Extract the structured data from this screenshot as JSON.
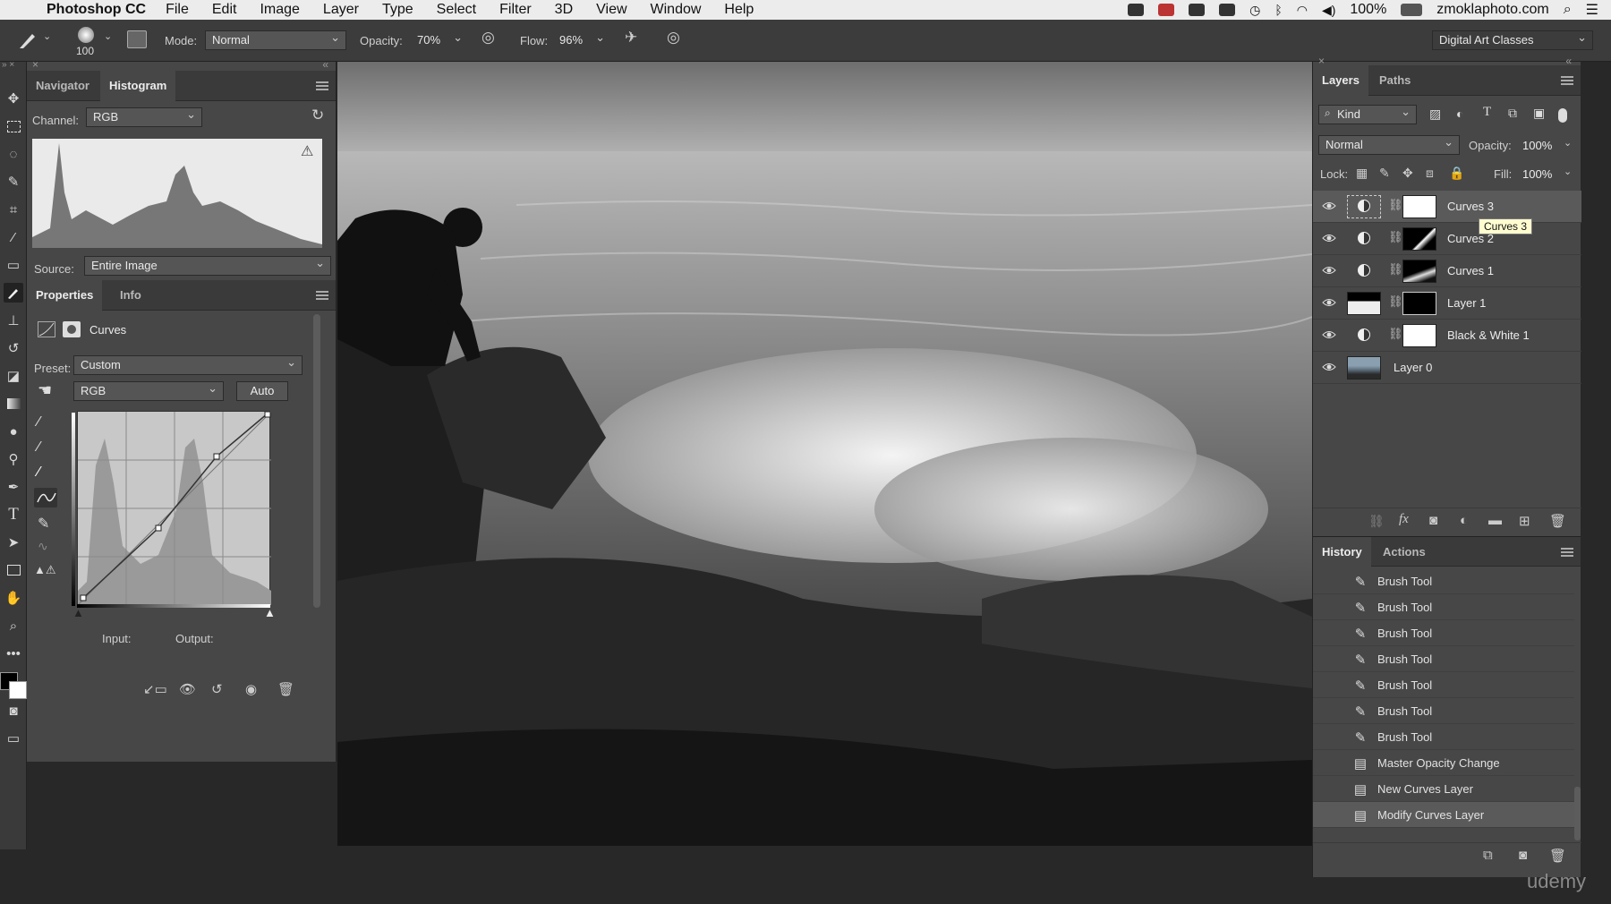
{
  "menubar": {
    "apple_glyph": "",
    "app_name": "Photoshop CC",
    "items": [
      "File",
      "Edit",
      "Image",
      "Layer",
      "Type",
      "Select",
      "Filter",
      "3D",
      "View",
      "Window",
      "Help"
    ],
    "battery": "100%",
    "site": "zmoklaphoto.com"
  },
  "options": {
    "brush_size": "100",
    "mode_label": "Mode:",
    "mode_value": "Normal",
    "opacity_label": "Opacity:",
    "opacity_value": "70%",
    "flow_label": "Flow:",
    "flow_value": "96%",
    "workspace": "Digital Art Classes"
  },
  "histogram_panel": {
    "tabs": [
      "Navigator",
      "Histogram"
    ],
    "channel_label": "Channel:",
    "channel_value": "RGB",
    "source_label": "Source:",
    "source_value": "Entire Image"
  },
  "properties_panel": {
    "tabs": [
      "Properties",
      "Info"
    ],
    "type_label": "Curves",
    "preset_label": "Preset:",
    "preset_value": "Custom",
    "channel_value": "RGB",
    "auto_label": "Auto",
    "input_label": "Input:",
    "output_label": "Output:"
  },
  "layers_panel": {
    "tabs": [
      "Layers",
      "Paths"
    ],
    "filter_value": "Kind",
    "blend_value": "Normal",
    "opacity_label": "Opacity:",
    "opacity_value": "100%",
    "lock_label": "Lock:",
    "fill_label": "Fill:",
    "fill_value": "100%",
    "tooltip": "Curves 3",
    "layers": [
      {
        "name": "Curves 3"
      },
      {
        "name": "Curves 2"
      },
      {
        "name": "Curves 1"
      },
      {
        "name": "Layer 1"
      },
      {
        "name": "Black & White 1"
      },
      {
        "name": "Layer 0"
      }
    ]
  },
  "history_panel": {
    "tabs": [
      "History",
      "Actions"
    ],
    "items": [
      {
        "label": "Brush Tool",
        "icon": "brush-icon"
      },
      {
        "label": "Brush Tool",
        "icon": "brush-icon"
      },
      {
        "label": "Brush Tool",
        "icon": "brush-icon"
      },
      {
        "label": "Brush Tool",
        "icon": "brush-icon"
      },
      {
        "label": "Brush Tool",
        "icon": "brush-icon"
      },
      {
        "label": "Brush Tool",
        "icon": "brush-icon"
      },
      {
        "label": "Brush Tool",
        "icon": "brush-icon"
      },
      {
        "label": "Master Opacity Change",
        "icon": "document-icon"
      },
      {
        "label": "New Curves Layer",
        "icon": "document-icon"
      },
      {
        "label": "Modify Curves Layer",
        "icon": "document-icon"
      }
    ]
  },
  "watermark": "udemy",
  "colors": {
    "panel_bg": "#474747",
    "selected_row": "#5a5a5a",
    "tooltip_bg": "#fffdd0"
  }
}
